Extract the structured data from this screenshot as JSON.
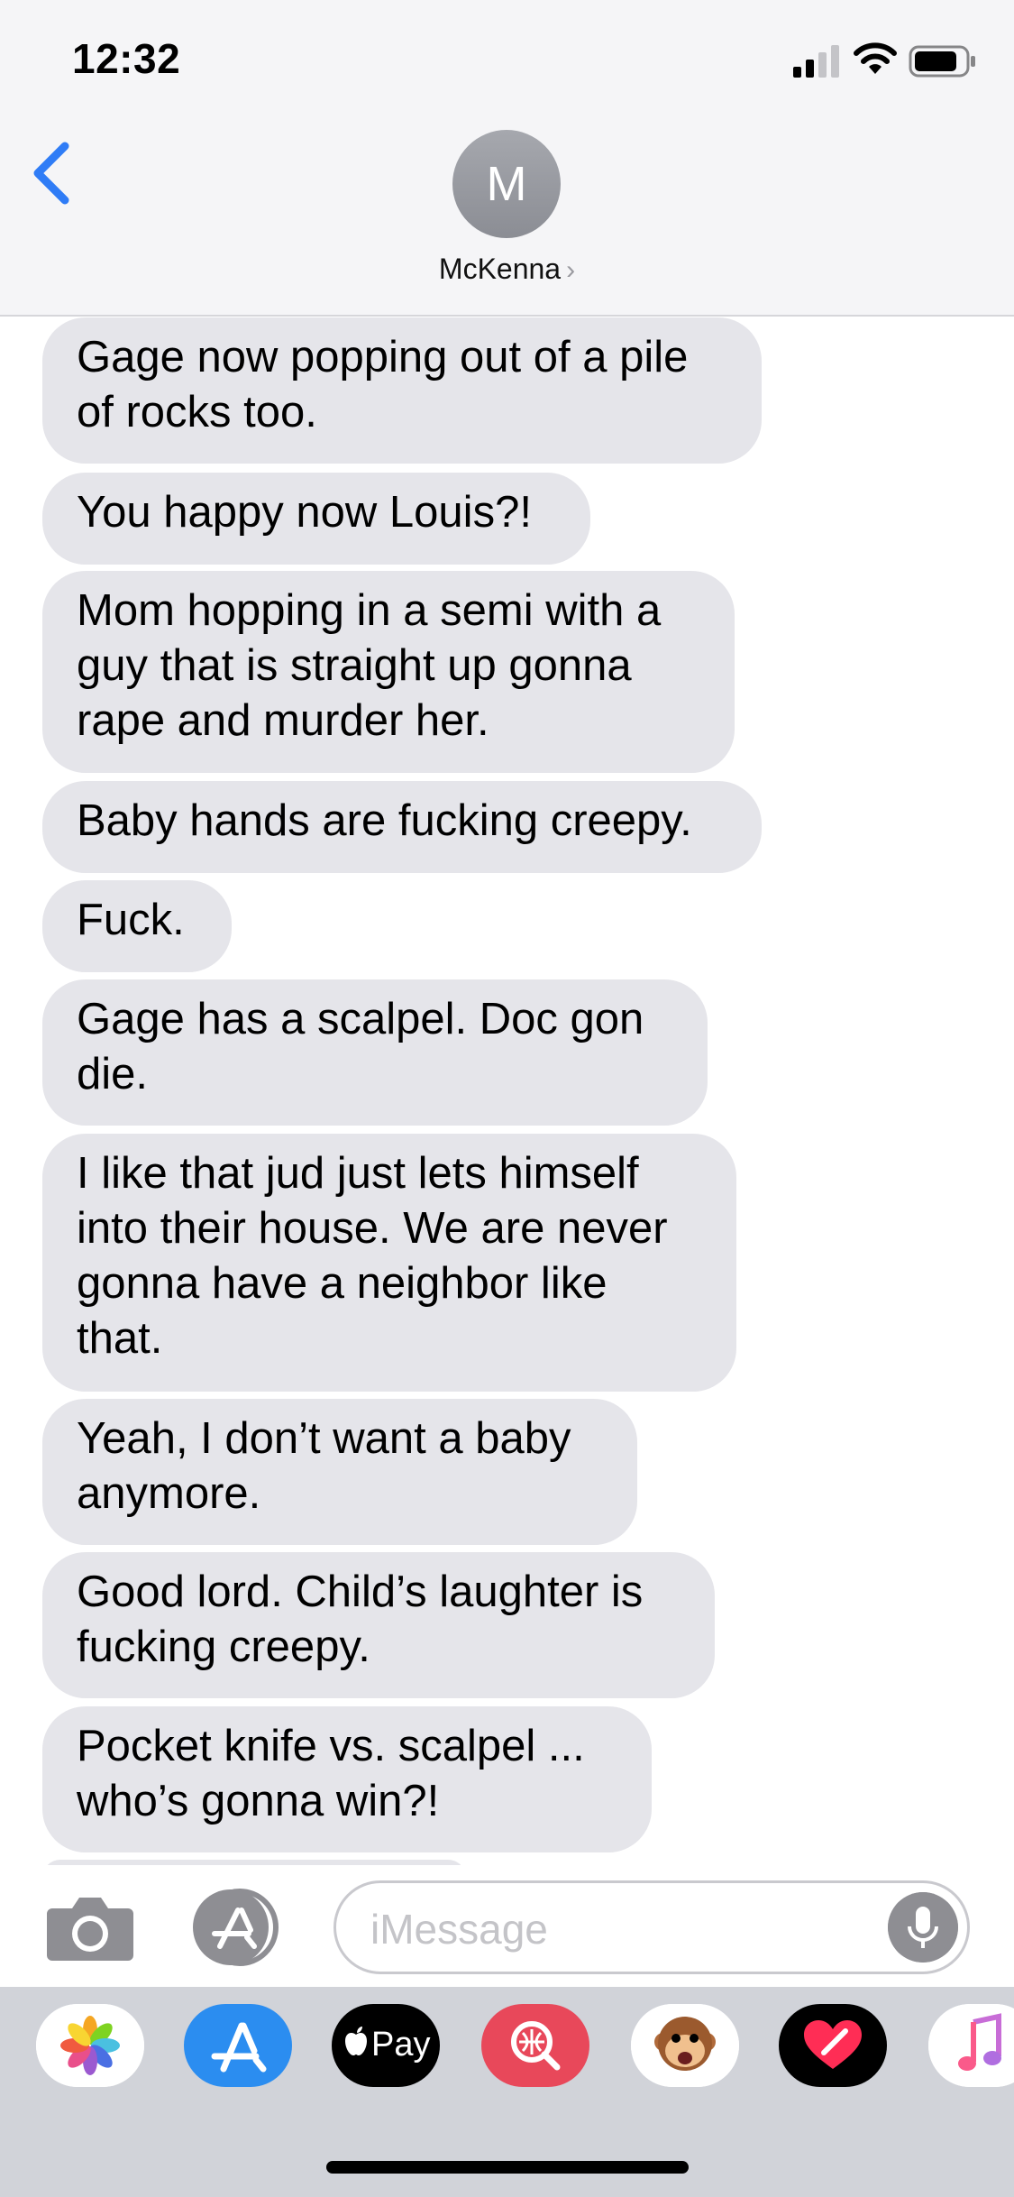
{
  "status_bar": {
    "time": "12:32"
  },
  "header": {
    "contact_initial": "M",
    "contact_name": "McKenna",
    "contact_chevron": "›"
  },
  "messages": [
    {
      "text": "Gage now popping out of a pile\nof rocks too."
    },
    {
      "text": "You happy now Louis?!"
    },
    {
      "text": "Mom hopping in a semi with a\nguy that is straight up gonna\nrape and murder her."
    },
    {
      "text": "Baby hands are fucking creepy."
    },
    {
      "text": "Fuck."
    },
    {
      "text": "Gage has a scalpel. Doc gon\ndie."
    },
    {
      "text": "I like that jud just lets himself\ninto their house. We are never\ngonna have a neighbor like\nthat."
    },
    {
      "text": "Yeah, I don’t want a baby\nanymore."
    },
    {
      "text": "Good lord. Child’s laughter is\nfucking creepy."
    },
    {
      "text": "Pocket knife vs. scalpel ...\nwho’s gonna win?!"
    }
  ],
  "input": {
    "placeholder": "iMessage"
  },
  "app_drawer": {
    "pay_label": "Pay",
    "apps": [
      "photos-app-icon",
      "app-store-app-icon",
      "apple-pay-app-icon",
      "images-search-app-icon",
      "animoji-app-icon",
      "digital-touch-app-icon",
      "music-app-icon"
    ]
  },
  "colors": {
    "bubble": "#e5e5ea",
    "ios_blue": "#2f7cf6",
    "header_bg": "#f5f5f7",
    "drawer_bg": "#d1d3d9"
  }
}
